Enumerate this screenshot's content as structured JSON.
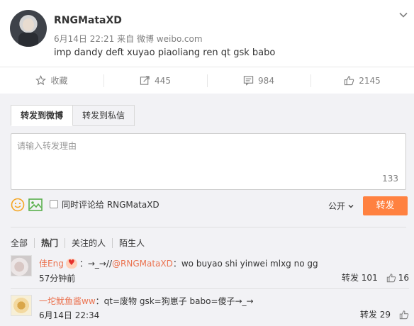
{
  "post": {
    "username": "RNGMataXD",
    "date": "6月14日 22:21",
    "source_prefix": "来自",
    "source": "微博 weibo.com",
    "text": "imp dandy deft xuyao piaoliang ren qt gsk babo"
  },
  "actions": {
    "favorite_label": "收藏",
    "forward_count": "445",
    "comment_count": "984",
    "like_count": "2145"
  },
  "forward_panel": {
    "tabs": [
      "转发到微博",
      "转发到私信"
    ],
    "placeholder": "请输入转发理由",
    "char_count": "133",
    "sync_label": "同时评论给 RNGMataXD",
    "privacy": "公开",
    "submit_label": "转发"
  },
  "filters": [
    "全部",
    "热门",
    "关注的人",
    "陌生人"
  ],
  "comments": [
    {
      "user": "佳Eng",
      "text_prefix": "：→_→//",
      "mention": "@RNGMataXD",
      "text": "：wo  buyao shi yinwei mlxg no gg",
      "time": "57分钟前",
      "forward": "转发 101",
      "likes": "16"
    },
    {
      "user": "一坨鱿鱼酱ww",
      "text": "：qt=废物 gsk=狗崽子 babo=傻子→_→",
      "time": "6月14日 22:34",
      "forward": "转发 29"
    }
  ],
  "colors": {
    "accent": "#ff8140",
    "link": "#eb7350",
    "panel_bg": "#f2f2f5"
  }
}
